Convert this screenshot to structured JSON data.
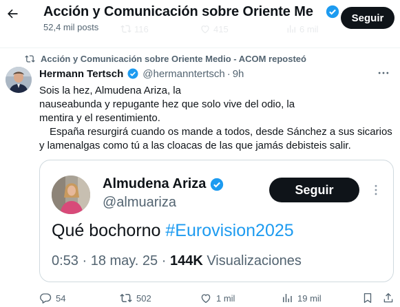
{
  "header": {
    "title": "Acción y Comunicación sobre Oriente Me",
    "subtitle": "52,4 mil posts",
    "follow_label": "Seguir",
    "ghost_counts": {
      "retweets": "116",
      "likes": "415",
      "views": "6 mil"
    }
  },
  "tweet": {
    "retweet_label": "Acción y Comunicación sobre Oriente Medio - ACOM reposteó",
    "author_name": "Hermann Tertsch",
    "author_handle": "@hermanntertsch",
    "separator": "·",
    "time": "9h",
    "text_lines": [
      "Sois la hez, Almudena Ariza, la",
      "nauseabunda y repugante hez que solo vive del odio, la",
      "mentira y el resentimiento.",
      "España resurgirá cuando os mande a todos, desde Sánchez a sus sicarios",
      "y lamenalgas como tú a las cloacas de las que jamás debisteis salir."
    ]
  },
  "embed": {
    "name": "Almudena Ariza",
    "handle": "@almuariza",
    "follow_label": "Seguir",
    "text": "Qué bochorno",
    "hashtag": "#Eurovision2025",
    "time": "0:53 · 18 may. 25 ·",
    "views_count": "144K",
    "views_label": "Visualizaciones"
  },
  "actions": {
    "replies": "54",
    "reposts": "502",
    "likes": "1 mil",
    "views": "19 mil"
  },
  "colors": {
    "text": "#0f1419",
    "secondary": "#536471",
    "accent": "#1d9bf0",
    "border": "#cfd9de",
    "button_bg": "#0f1419"
  },
  "icons": [
    "back-arrow-icon",
    "verified-badge-icon",
    "retweet-icon",
    "more-icon",
    "reply-icon",
    "like-icon",
    "views-icon",
    "bookmark-icon",
    "share-icon"
  ]
}
